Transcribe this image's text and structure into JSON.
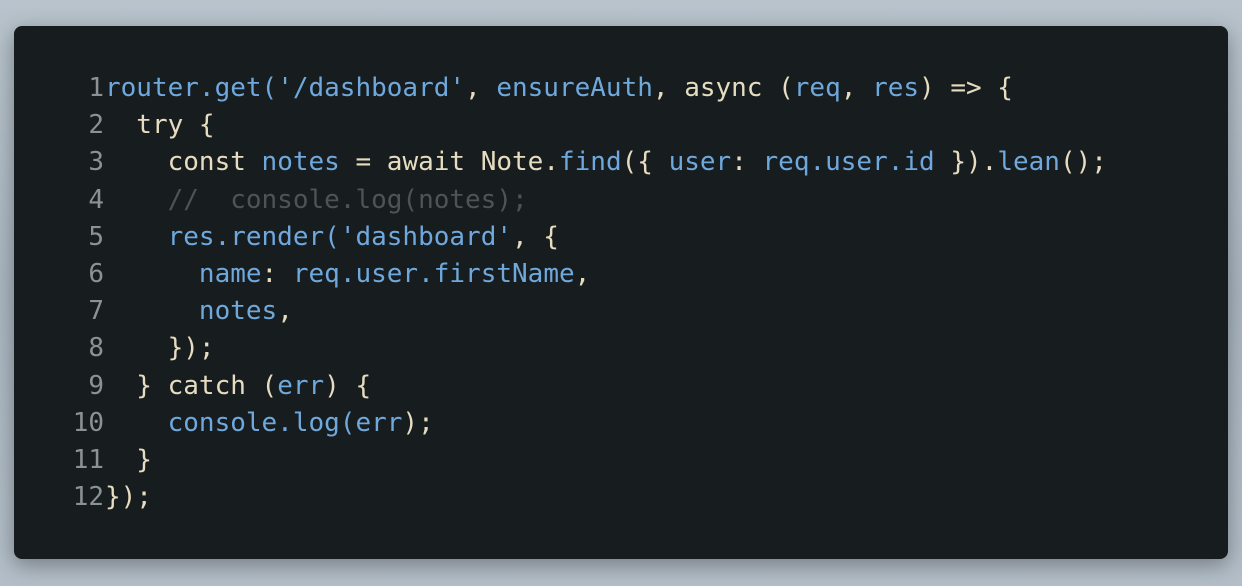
{
  "colors": {
    "background": "#b3bec8",
    "editor": "#171c1f",
    "line_number": "#8b9195",
    "default": "#e6dcc0",
    "function": "#6fa8dc",
    "string": "#6fa8dc",
    "property": "#6fa8dc",
    "comment": "#4d5457"
  },
  "code": {
    "lines": [
      {
        "number": "1",
        "tokens": [
          {
            "text": "router.get(",
            "kind": "function"
          },
          {
            "text": "'/dashboard'",
            "kind": "string"
          },
          {
            "text": ", ",
            "kind": "default"
          },
          {
            "text": "ensureAuth",
            "kind": "function"
          },
          {
            "text": ", async (",
            "kind": "default"
          },
          {
            "text": "req",
            "kind": "property"
          },
          {
            "text": ", ",
            "kind": "default"
          },
          {
            "text": "res",
            "kind": "property"
          },
          {
            "text": ") => {",
            "kind": "default"
          }
        ]
      },
      {
        "number": "2",
        "tokens": [
          {
            "text": "  try {",
            "kind": "default"
          }
        ]
      },
      {
        "number": "3",
        "tokens": [
          {
            "text": "    const ",
            "kind": "default"
          },
          {
            "text": "notes",
            "kind": "property"
          },
          {
            "text": " = await Note.",
            "kind": "default"
          },
          {
            "text": "find",
            "kind": "function"
          },
          {
            "text": "({ ",
            "kind": "default"
          },
          {
            "text": "user",
            "kind": "property"
          },
          {
            "text": ": ",
            "kind": "default"
          },
          {
            "text": "req.user.id",
            "kind": "property"
          },
          {
            "text": " }).",
            "kind": "default"
          },
          {
            "text": "lean",
            "kind": "function"
          },
          {
            "text": "();",
            "kind": "default"
          }
        ]
      },
      {
        "number": "4",
        "tokens": [
          {
            "text": "    //  console.log(notes);",
            "kind": "comment"
          }
        ]
      },
      {
        "number": "5",
        "tokens": [
          {
            "text": "    res.render(",
            "kind": "function"
          },
          {
            "text": "'dashboard'",
            "kind": "string"
          },
          {
            "text": ", {",
            "kind": "default"
          }
        ]
      },
      {
        "number": "6",
        "tokens": [
          {
            "text": "      name",
            "kind": "property"
          },
          {
            "text": ": ",
            "kind": "default"
          },
          {
            "text": "req.user.firstName",
            "kind": "property"
          },
          {
            "text": ",",
            "kind": "default"
          }
        ]
      },
      {
        "number": "7",
        "tokens": [
          {
            "text": "      notes",
            "kind": "property"
          },
          {
            "text": ",",
            "kind": "default"
          }
        ]
      },
      {
        "number": "8",
        "tokens": [
          {
            "text": "    });",
            "kind": "default"
          }
        ]
      },
      {
        "number": "9",
        "tokens": [
          {
            "text": "  } catch (",
            "kind": "default"
          },
          {
            "text": "err",
            "kind": "property"
          },
          {
            "text": ") {",
            "kind": "default"
          }
        ]
      },
      {
        "number": "10",
        "tokens": [
          {
            "text": "    console.log(",
            "kind": "function"
          },
          {
            "text": "err",
            "kind": "property"
          },
          {
            "text": ");",
            "kind": "default"
          }
        ]
      },
      {
        "number": "11",
        "tokens": [
          {
            "text": "  }",
            "kind": "default"
          }
        ]
      },
      {
        "number": "12",
        "tokens": [
          {
            "text": "});",
            "kind": "default"
          }
        ]
      }
    ]
  }
}
